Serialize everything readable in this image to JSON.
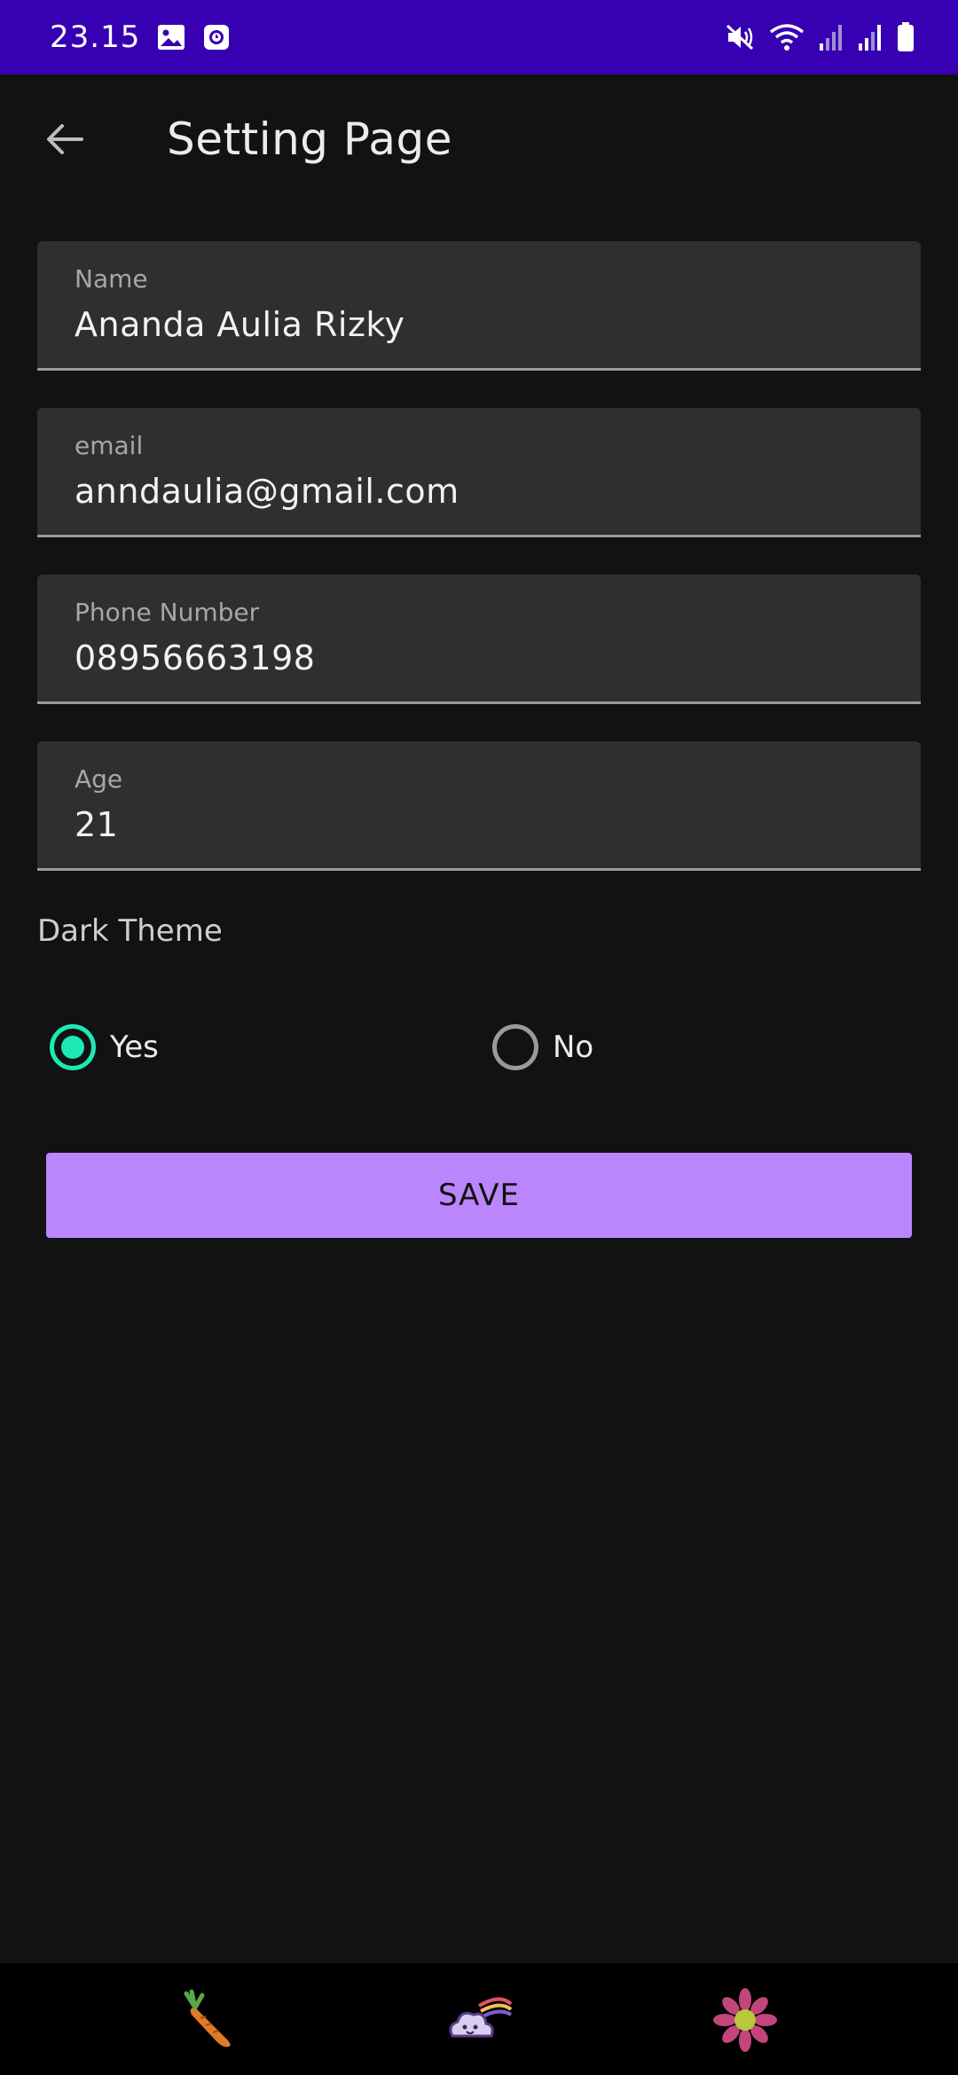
{
  "status_bar": {
    "time": "23.15",
    "icons": [
      "gallery-icon",
      "clock-app-icon",
      "mute-icon",
      "wifi-icon",
      "signal-icon",
      "signal-icon",
      "battery-icon"
    ],
    "background": "#3700b3"
  },
  "header": {
    "back_icon": "arrow-left-icon",
    "title": "Setting Page"
  },
  "form": {
    "name": {
      "label": "Name",
      "value": "Ananda Aulia Rizky"
    },
    "email": {
      "label": "email",
      "value": "anndaulia@gmail.com"
    },
    "phone": {
      "label": "Phone Number",
      "value": "08956663198"
    },
    "age": {
      "label": "Age",
      "value": "21"
    }
  },
  "theme": {
    "label": "Dark Theme",
    "options": [
      {
        "label": "Yes",
        "selected": true
      },
      {
        "label": "No",
        "selected": false
      }
    ],
    "accent": "#1de9b6"
  },
  "save_button": {
    "label": "SAVE",
    "color": "#bb86fc"
  },
  "bottom_nav": {
    "items": [
      {
        "icon": "carrot-icon"
      },
      {
        "icon": "rainbow-cloud-icon"
      },
      {
        "icon": "flower-icon"
      }
    ]
  },
  "colors": {
    "background": "#121212",
    "field_background": "#2f2f2f"
  }
}
